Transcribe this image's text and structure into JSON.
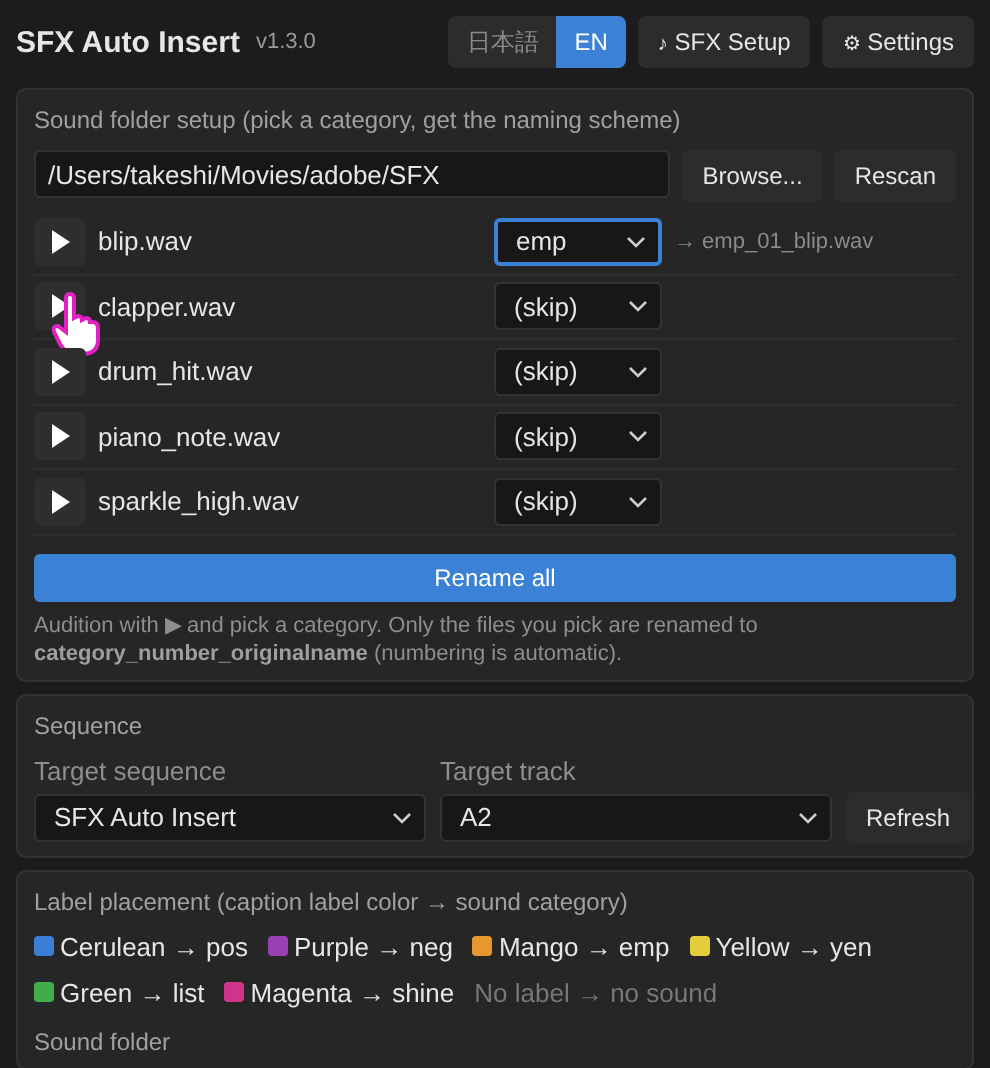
{
  "header": {
    "title": "SFX Auto Insert",
    "version": "v1.3.0",
    "languages": [
      {
        "label": "日本語",
        "selected": false
      },
      {
        "label": "EN",
        "selected": true
      }
    ],
    "buttons": [
      {
        "icon": "♪",
        "label": "SFX Setup"
      },
      {
        "icon": "⚙",
        "label": "Settings"
      }
    ]
  },
  "sound_setup": {
    "heading": "Sound folder setup (pick a category, get the naming scheme)",
    "folder_path": "/Users/takeshi/Movies/adobe/SFX",
    "buttons": [
      "Browse...",
      "Rescan"
    ],
    "files": [
      {
        "name": "blip.wav",
        "category": "emp",
        "focused": true,
        "preview": "→ emp_01_blip.wav"
      },
      {
        "name": "clapper.wav",
        "category": "(skip)",
        "focused": false
      },
      {
        "name": "drum_hit.wav",
        "category": "(skip)",
        "focused": false
      },
      {
        "name": "piano_note.wav",
        "category": "(skip)",
        "focused": false
      },
      {
        "name": "sparkle_high.wav",
        "category": "(skip)",
        "focused": false
      }
    ],
    "rename_button": "Rename all",
    "help": "Audition with ▶ and pick a category. Only the files you pick are renamed to **category_number_originalname** (numbering is automatic)."
  },
  "sequence": {
    "heading": "Sequence",
    "target_sequence_label": "Target sequence",
    "target_sequence": "SFX Auto Insert",
    "target_track_label": "Target track",
    "target_track": "A2",
    "refresh_button": "Refresh"
  },
  "label_placement": {
    "heading": "Label placement (caption label color → sound category)",
    "mappings": [
      {
        "label": "Cerulean → pos",
        "color": "#3a7fd5"
      },
      {
        "label": "Purple → neg",
        "color": "#9b3fb5"
      },
      {
        "label": "Mango → emp",
        "color": "#e8962e"
      },
      {
        "label": "Yellow → yen",
        "color": "#e3cd3a"
      },
      {
        "label": "Green → list",
        "color": "#3fae4a"
      },
      {
        "label": "Magenta → shine",
        "color": "#d0338a"
      }
    ],
    "no_label_note": "No label → no sound",
    "sound_folder_label": "Sound folder"
  }
}
